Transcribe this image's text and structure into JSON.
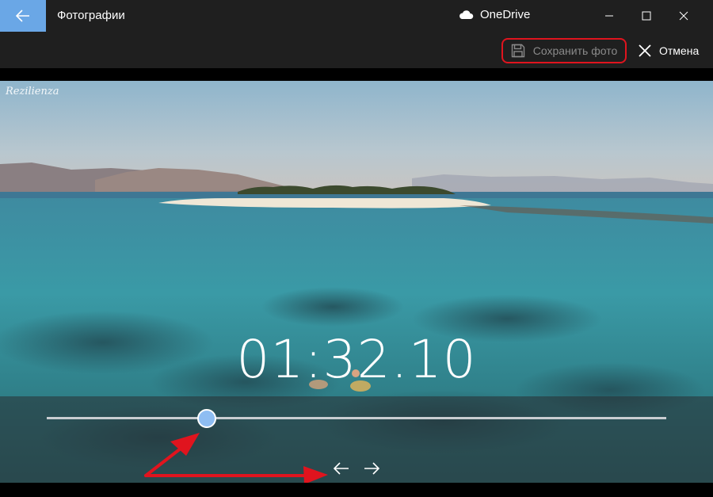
{
  "window": {
    "title": "Фотографии",
    "cloud_label": "OneDrive",
    "icons": {
      "back": "back-arrow-icon",
      "cloud": "cloud-icon",
      "minimize": "minimize-icon",
      "maximize": "maximize-icon",
      "close": "close-icon"
    }
  },
  "toolbar": {
    "save_label": "Сохранить фото",
    "cancel_label": "Отмена",
    "save_icon": "floppy-disk-icon",
    "cancel_icon": "close-x-icon"
  },
  "video": {
    "watermark": "Rezilienza",
    "timecode": "01:32.10",
    "position_fraction": 0.258
  },
  "controls": {
    "prev_icon": "arrow-left-icon",
    "next_icon": "arrow-right-icon"
  },
  "colors": {
    "accent": "#6aa7e6",
    "highlight": "#e0141e",
    "thumb": "#8ebdf2"
  }
}
